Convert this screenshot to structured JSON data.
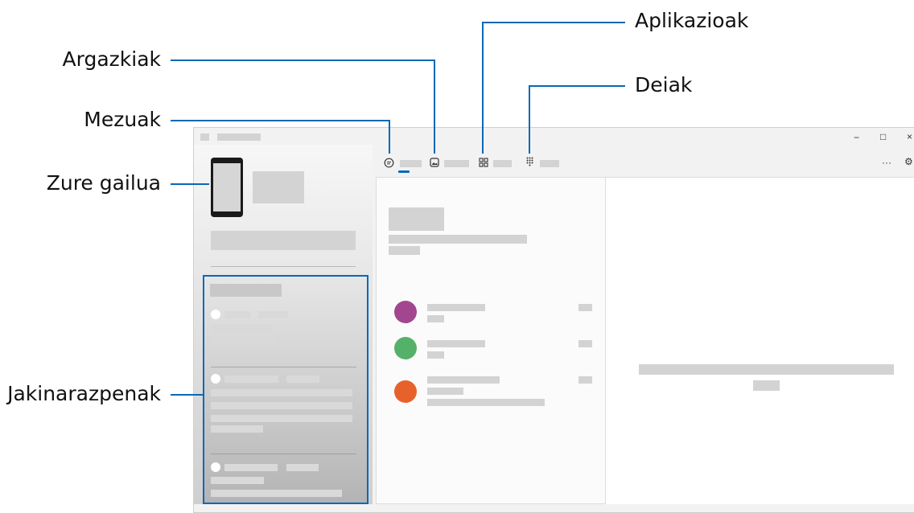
{
  "callouts": {
    "aplikazioak": "Aplikazioak",
    "argazkiak": "Argazkiak",
    "deiak": "Deiak",
    "mezuak": "Mezuak",
    "zure_gailua": "Zure gailua",
    "jakinarazpenak": "Jakinarazpenak"
  },
  "window": {
    "controls": {
      "minimize": "−",
      "maximize": "□",
      "close": "×"
    },
    "toolbar": {
      "more": "···",
      "settings": "⚙"
    }
  },
  "tabs": [
    {
      "icon": "message-icon",
      "glyph": "◌"
    },
    {
      "icon": "photo-icon",
      "glyph": "▣"
    },
    {
      "icon": "apps-icon",
      "glyph": "⊞"
    },
    {
      "icon": "dialpad-icon",
      "glyph": "⠿"
    }
  ],
  "colors": {
    "callout_line": "#0a68b5",
    "avatar_1": "#a1468f",
    "avatar_2": "#55b06a",
    "avatar_3": "#e7622a",
    "placeholder": "#d3d3d3"
  }
}
